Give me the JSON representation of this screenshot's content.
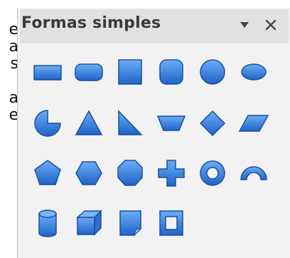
{
  "background_fragments": [
    "e",
    "a",
    "s",
    "",
    "a",
    "e"
  ],
  "panel": {
    "title": "Formas simples",
    "menu_icon": "triangle-down-icon",
    "close_icon": "close-icon"
  },
  "shapes": [
    {
      "name": "rectangle"
    },
    {
      "name": "rounded-rectangle"
    },
    {
      "name": "square"
    },
    {
      "name": "rounded-square"
    },
    {
      "name": "circle"
    },
    {
      "name": "ellipse"
    },
    {
      "name": "circle-pie"
    },
    {
      "name": "isosceles-triangle"
    },
    {
      "name": "right-triangle"
    },
    {
      "name": "trapezoid"
    },
    {
      "name": "diamond"
    },
    {
      "name": "parallelogram"
    },
    {
      "name": "pentagon"
    },
    {
      "name": "hexagon"
    },
    {
      "name": "octagon"
    },
    {
      "name": "cross"
    },
    {
      "name": "ring"
    },
    {
      "name": "block-arc"
    },
    {
      "name": "cylinder"
    },
    {
      "name": "cube"
    },
    {
      "name": "folded-corner"
    },
    {
      "name": "frame"
    }
  ],
  "colors": {
    "shape_light": "#5aa0ee",
    "shape_dark": "#1e5fc4",
    "shape_stroke": "#1c4f9e"
  }
}
